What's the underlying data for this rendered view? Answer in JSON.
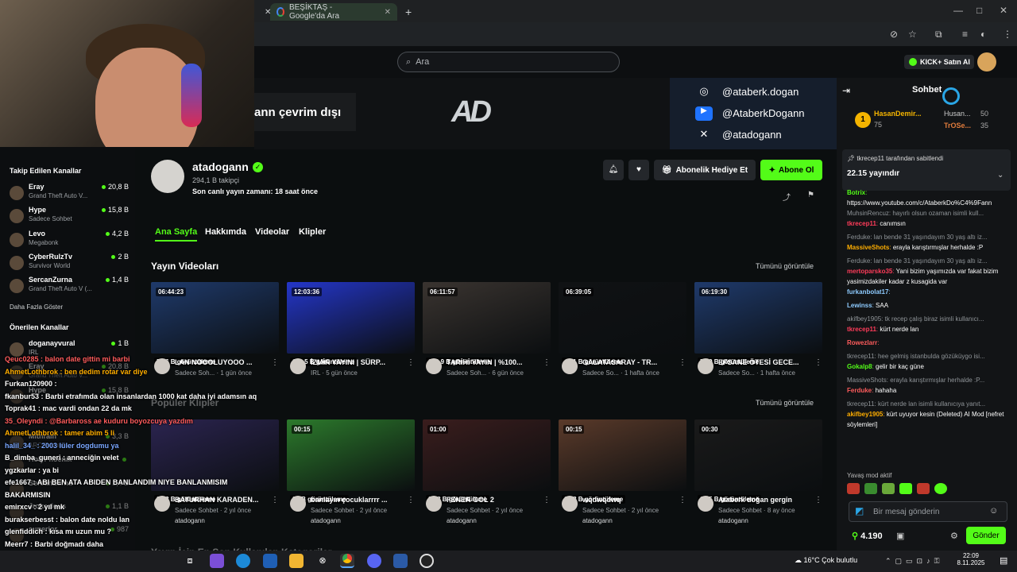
{
  "browser": {
    "tab_title": "BEŞİKTAŞ - Google'da Ara",
    "new_tab": "+"
  },
  "kick": {
    "search_placeholder": "Ara",
    "kick_button": "KICK+ Satın Al",
    "offline_text": "ann çevrim dışı",
    "logo_text": "AD",
    "socials": [
      {
        "icon": "instagram-icon",
        "handle": "@ataberk.dogan"
      },
      {
        "icon": "youtube-icon",
        "handle": "@AtaberkDogann"
      },
      {
        "icon": "x-twitter-icon",
        "handle": "@atadogann"
      }
    ]
  },
  "sidebar": {
    "followed_title": "Takip Edilen Kanallar",
    "followed": [
      {
        "name": "Eray",
        "category": "Grand Theft Auto V...",
        "viewers": "20,8 B"
      },
      {
        "name": "Hype",
        "category": "Sadece Sohbet",
        "viewers": "15,8 B"
      },
      {
        "name": "Levo",
        "category": "Megabonk",
        "viewers": "4,2 B"
      },
      {
        "name": "CyberRulzTv",
        "category": "Survivor World",
        "viewers": "2 B"
      },
      {
        "name": "SercanZurna",
        "category": "Grand Theft Auto V (...",
        "viewers": "1,4 B"
      }
    ],
    "show_more": "Daha Fazla Göster",
    "recommended_title": "Önerilen Kanallar",
    "recommended": [
      {
        "name": "doganayvural",
        "category": "IRL",
        "viewers": "1 B"
      },
      {
        "name": "Eray",
        "category": "Grand Theft Auto V...",
        "viewers": "20,8 B"
      },
      {
        "name": "Hype",
        "category": "",
        "viewers": "15,8 B"
      },
      {
        "name": "Mithrain",
        "category": "ARC Raiders",
        "viewers": "3,3 B"
      },
      {
        "name": "HolyPhoenix",
        "category": "",
        "viewers": ""
      },
      {
        "name": "SercanZurna",
        "category": "",
        "viewers": "1,4 B"
      },
      {
        "name": "Jrokezious",
        "category": "",
        "viewers": "1,1 B"
      },
      {
        "name": "superior",
        "category": "",
        "viewers": "987"
      }
    ]
  },
  "channel": {
    "name": "atadogann",
    "followers": "294,1 B takipçi",
    "last_live": "Son canlı yayın zamanı: 18 saat önce",
    "gift_button": "Abonelik Hediye Et",
    "subscribe_button": "Abone Ol",
    "tabs": [
      "Ana Sayfa",
      "Hakkımda",
      "Videolar",
      "Klipler"
    ],
    "videos_title": "Yayın Videoları",
    "see_all": "Tümünü görüntüle",
    "clips_title": "Popüler Klipler",
    "bottom_title": "Yayın İçin En Son Kullanılan Kategoriler"
  },
  "videos": [
    {
      "duration": "06:44:23",
      "views": "57,6 B görüntüleme",
      "title": "LAN NOOOLUYOOO ...",
      "meta": "Sadece Soh... · 1 gün önce",
      "color": "#1f3a6b"
    },
    {
      "duration": "12:03:36",
      "views": "110,5 B görüntüleme",
      "title": "İZMİR YAYINI | SÜRP...",
      "meta": "IRL · 5 gün önce",
      "color": "#2436c9"
    },
    {
      "duration": "06:11:57",
      "views": "109,9 B görüntüleme",
      "title": "TARİHİ YAYIN | %100...",
      "meta": "Sadece Soh... · 6 gün önce",
      "color": "#3a3430"
    },
    {
      "duration": "06:39:05",
      "views": "44,1 B görüntüleme",
      "title": "GALATASARAY - TR...",
      "meta": "Sadece So... · 1 hafta önce",
      "color": "#101214"
    },
    {
      "duration": "06:19:30",
      "views": "56,9 B görüntüleme",
      "title": "EFSANE ÖTESİ GECE...",
      "meta": "Sadece So... · 1 hafta önce",
      "color": "#1f3a6b"
    }
  ],
  "clips": [
    {
      "duration": "",
      "views": "37,3 B görüntüleme",
      "title": "BATURHAN KARADEN...",
      "meta": "Sadece Sohbet · 2 yıl önce",
      "author": "atadogann",
      "color": "#2b2450"
    },
    {
      "duration": "00:15",
      "views": "27 B görüntüleme",
      "title": "banlayın çocuklarrrr ...",
      "meta": "Sadece Sohbet · 2 yıl önce",
      "author": "atadogann",
      "color": "#2c7a2c"
    },
    {
      "duration": "01:00",
      "views": "20,8 B görüntüleme",
      "title": "FENER GOL 2",
      "meta": "Sadece Sohbet · 2 yıl önce",
      "author": "atadogann",
      "color": "#3a1d1d"
    },
    {
      "duration": "00:15",
      "views": "16,8 B görüntüleme",
      "title": "wqdwqdwq",
      "meta": "Sadece Sohbet · 2 yıl önce",
      "author": "atadogann",
      "color": "#5a3a2a"
    },
    {
      "duration": "00:30",
      "views": "13,5 B görüntüleme",
      "title": "Ataberk doğan gergin",
      "meta": "Sadece Sohbet · 8 ay önce",
      "author": "atadogann",
      "color": "#1a1a1a"
    }
  ],
  "overlay_chat": [
    {
      "color": "#ff5c5c",
      "text": "Qeuc0285 : balon date gittin mi barbi"
    },
    {
      "color": "#ffae00",
      "text": "AhmetLothbrok : ben dedim rotar var diye"
    },
    {
      "color": "#ffffff",
      "text": "Furkan120900 :"
    },
    {
      "color": "#ffffff",
      "text": "fkanbur53 : Barbi etrafımda olan insanlardan 1000 kat daha iyi adamsın aq"
    },
    {
      "color": "#ffffff",
      "text": "Toprak41 : mac vardi ondan 22 da mk"
    },
    {
      "color": "#ff5c5c",
      "text": "35_Oleyndi : @Barbaross ae kuduru boyozcuya yazdım"
    },
    {
      "color": "#ffae00",
      "text": "AhmetLothbrok : tamer abim 5 li"
    },
    {
      "color": "#7aa7ff",
      "text": "halil_34_ : 2003 lüler dogdumu ya"
    },
    {
      "color": "#ffffff",
      "text": "B_dimba_guneri : anneciğin velet"
    },
    {
      "color": "#ffffff",
      "text": "ygzkarlar : ya bi"
    },
    {
      "color": "#ffffff",
      "text": "efe1667 : ABI BEN ATA ABIDEN BANLANDIM NIYE BANLANMISIM"
    },
    {
      "color": "#ffffff",
      "text": "BAKARMISIN"
    },
    {
      "color": "#ffffff",
      "text": "emirxcv : 2 yıl mk"
    },
    {
      "color": "#ffffff",
      "text": "burakserbesst : balon date noldu lan"
    },
    {
      "color": "#ffffff",
      "text": "glenfiddich : kısa mı uzun mu ?"
    },
    {
      "color": "#ffffff",
      "text": "Meerr7 : Barbi doğmadı daha"
    }
  ],
  "chat": {
    "title": "Sohbet",
    "leaders": [
      {
        "rank": "1",
        "name": "HasanDemir...",
        "points": "75"
      },
      {
        "rank": "",
        "name": "Husan...",
        "points": "50"
      },
      {
        "rank": "",
        "name": "TrOSe...",
        "points": "35"
      }
    ],
    "pinned_by": "tkrecep11 tarafından sabitlendi",
    "pinned_text": "22.15 yayındır",
    "messages": [
      {
        "reply": "",
        "user": "Botrix",
        "color": "#53fc18",
        "text": "https://www.youtube.com/c/AtaberkDo%C4%9Fann"
      },
      {
        "reply": "MuhsinRencuz: hayırlı olsun ozaman isimli kull...",
        "user": "tkrecep11",
        "color": "#ff3c5a",
        "text": "canımsın"
      },
      {
        "reply": "Ferduke: lan bende 31 yaşındayım 30 yaş altı iz...",
        "user": "MassiveShots",
        "color": "#ffae00",
        "text": "erayla karıştırmışlar herhalde :P"
      },
      {
        "reply": "Ferduke: lan bende 31 yaşındayım 30 yaş altı iz...",
        "user": "mertoparsko35",
        "color": "#ff3c5a",
        "text": "Yani bizim yaşımızda var fakat bizim yasimizdakiler kadar z kusagida var"
      },
      {
        "reply": "",
        "user": "furkanbolat17",
        "color": "#8ecbff",
        "text": ""
      },
      {
        "reply": "",
        "user": "Lewinss",
        "color": "#8ecbff",
        "text": "SAA"
      },
      {
        "reply": "akifbey1905: tk recep çalış biraz isimli kullanıcı...",
        "user": "tkrecep11",
        "color": "#ff3c5a",
        "text": "kürt nerde lan"
      },
      {
        "reply": "",
        "user": "Rowezlarr",
        "color": "#ff5c5c",
        "text": ""
      },
      {
        "reply": "tkrecep11: hee gelmiş istanbulda gözüküygo isi...",
        "user": "Gokalp8",
        "color": "#53fc18",
        "text": "gelir bir kaç güne"
      },
      {
        "reply": "MassiveShots: erayla karıştırmışlar herhalde :P...",
        "user": "Ferduke",
        "color": "#ff5c5c",
        "text": "hahaha"
      },
      {
        "reply": "tkrecep11: kürt nerde lan isimli kullanıcıya yanıt...",
        "user": "akifbey1905",
        "color": "#ffae00",
        "text": "kürt uyuyor kesin (Deleted) AI Mod [nefret söylemleri]"
      }
    ],
    "slow_mode": "Yavaş mod aktif",
    "input_placeholder": "Bir mesaj gönderin",
    "points": "4.190",
    "send_button": "Gönder"
  },
  "taskbar": {
    "weather": "16°C  Çok bulutlu",
    "time": "22:09",
    "date": "8.11.2025"
  }
}
